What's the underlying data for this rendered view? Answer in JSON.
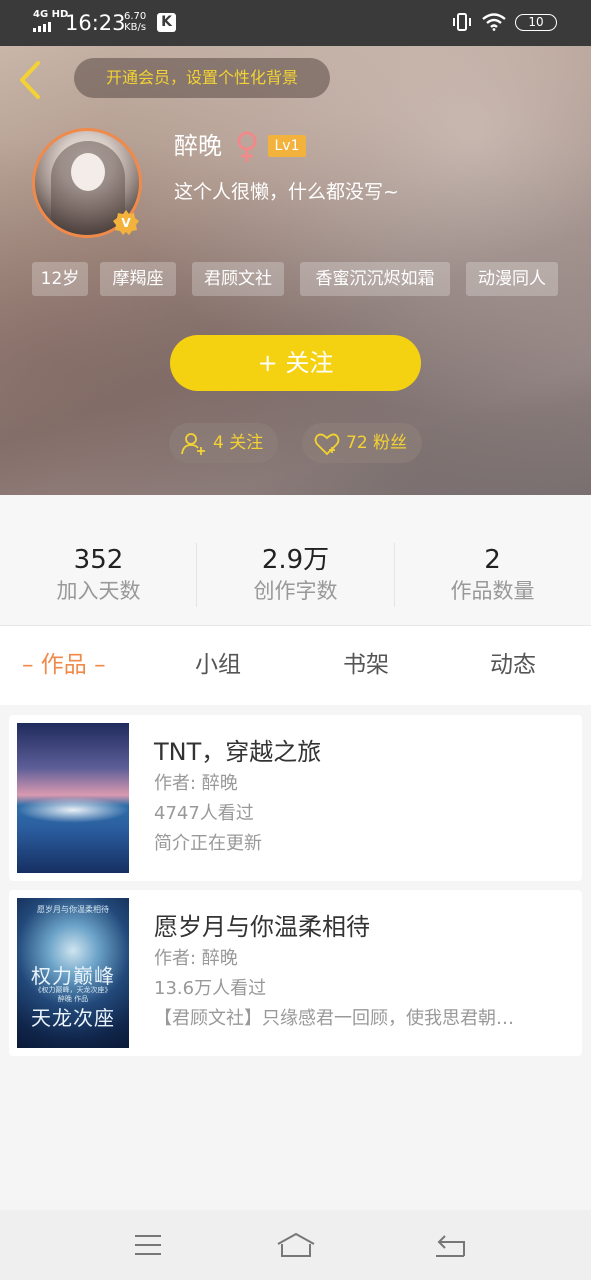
{
  "status_bar": {
    "network": "4G HD",
    "time": "16:23",
    "speed_value": "6.70",
    "speed_unit": "KB/s",
    "app_badge": "K",
    "battery": "10"
  },
  "header": {
    "vip_prompt": "开通会员，设置个性化背景",
    "nickname": "醉晚",
    "level": "Lv1",
    "bio": "这个人很懒，什么都没写~",
    "tags": [
      "12岁",
      "摩羯座",
      "君顾文社",
      "香蜜沉沉烬如霜",
      "动漫同人"
    ],
    "follow_label": "+  关注",
    "following_label": "4 关注",
    "fans_label": "72 粉丝"
  },
  "stats": [
    {
      "value": "352",
      "label": "加入天数"
    },
    {
      "value": "2.9万",
      "label": "创作字数"
    },
    {
      "value": "2",
      "label": "作品数量"
    }
  ],
  "tabs": {
    "works": "– 作品 –",
    "group": "小组",
    "shelf": "书架",
    "moments": "动态"
  },
  "works": [
    {
      "title": "TNT，穿越之旅",
      "author": "作者: 醉晚",
      "views": "4747人看过",
      "summary": "简介正在更新"
    },
    {
      "title": "愿岁月与你温柔相待",
      "author": "作者: 醉晚",
      "views": "13.6万人看过",
      "summary": "【君顾文社】只缘感君一回顾，使我思君朝…",
      "cover_small": "愿岁月与你温柔相待",
      "cover_title_1": "权力巅峰",
      "cover_sub": "《权力巅峰，天龙次座》\n醉晚 作品",
      "cover_title_2": "天龙次座"
    }
  ],
  "colors": {
    "accent_orange": "#f08a4b",
    "follow_yellow": "#f5d211",
    "gold_text": "#f3d233"
  }
}
